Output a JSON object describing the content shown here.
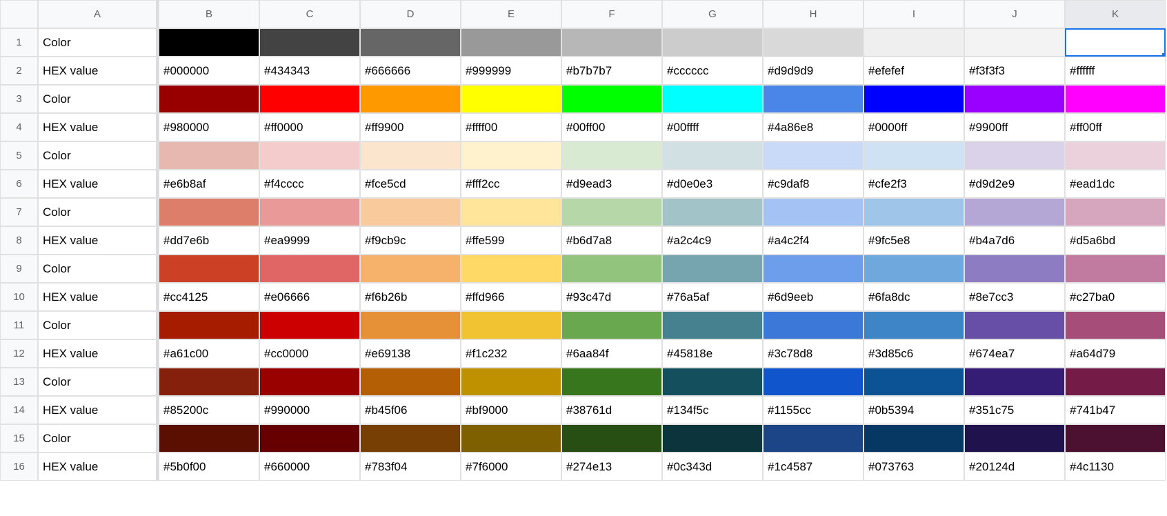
{
  "columns": [
    "A",
    "B",
    "C",
    "D",
    "E",
    "F",
    "G",
    "H",
    "I",
    "J",
    "K"
  ],
  "rowNumbers": [
    1,
    2,
    3,
    4,
    5,
    6,
    7,
    8,
    9,
    10,
    11,
    12,
    13,
    14,
    15,
    16
  ],
  "selected": "K1",
  "labels": {
    "color": "Color",
    "hex": "HEX value"
  },
  "palette": [
    [
      "#000000",
      "#434343",
      "#666666",
      "#999999",
      "#b7b7b7",
      "#cccccc",
      "#d9d9d9",
      "#efefef",
      "#f3f3f3",
      "#ffffff"
    ],
    [
      "#980000",
      "#ff0000",
      "#ff9900",
      "#ffff00",
      "#00ff00",
      "#00ffff",
      "#4a86e8",
      "#0000ff",
      "#9900ff",
      "#ff00ff"
    ],
    [
      "#e6b8af",
      "#f4cccc",
      "#fce5cd",
      "#fff2cc",
      "#d9ead3",
      "#d0e0e3",
      "#c9daf8",
      "#cfe2f3",
      "#d9d2e9",
      "#ead1dc"
    ],
    [
      "#dd7e6b",
      "#ea9999",
      "#f9cb9c",
      "#ffe599",
      "#b6d7a8",
      "#a2c4c9",
      "#a4c2f4",
      "#9fc5e8",
      "#b4a7d6",
      "#d5a6bd"
    ],
    [
      "#cc4125",
      "#e06666",
      "#f6b26b",
      "#ffd966",
      "#93c47d",
      "#76a5af",
      "#6d9eeb",
      "#6fa8dc",
      "#8e7cc3",
      "#c27ba0"
    ],
    [
      "#a61c00",
      "#cc0000",
      "#e69138",
      "#f1c232",
      "#6aa84f",
      "#45818e",
      "#3c78d8",
      "#3d85c6",
      "#674ea7",
      "#a64d79"
    ],
    [
      "#85200c",
      "#990000",
      "#b45f06",
      "#bf9000",
      "#38761d",
      "#134f5c",
      "#1155cc",
      "#0b5394",
      "#351c75",
      "#741b47"
    ],
    [
      "#5b0f00",
      "#660000",
      "#783f04",
      "#7f6000",
      "#274e13",
      "#0c343d",
      "#1c4587",
      "#073763",
      "#20124d",
      "#4c1130"
    ]
  ]
}
